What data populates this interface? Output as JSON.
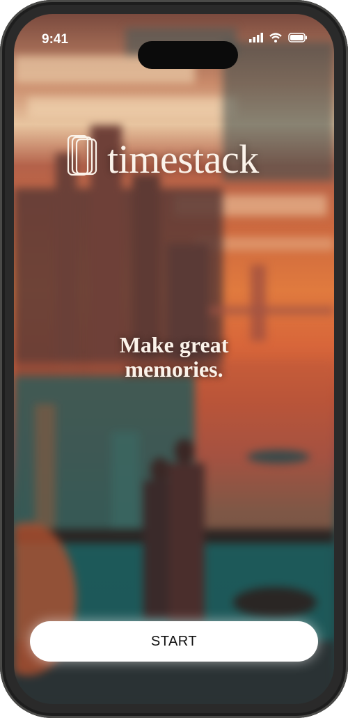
{
  "status_bar": {
    "time": "9:41",
    "icons": [
      "signal-icon",
      "wifi-icon",
      "battery-icon"
    ]
  },
  "brand": {
    "name": "timestack",
    "logo_icon": "stacked-cards-icon"
  },
  "hero": {
    "tagline_line1": "Make great",
    "tagline_line2": "memories."
  },
  "actions": {
    "start_label": "START"
  },
  "colors": {
    "text_light": "#fbf3ea",
    "button_bg": "#ffffff",
    "button_text": "#111111",
    "sunset_orange": "#e07a3e",
    "teal_water": "#1f4a4e"
  }
}
